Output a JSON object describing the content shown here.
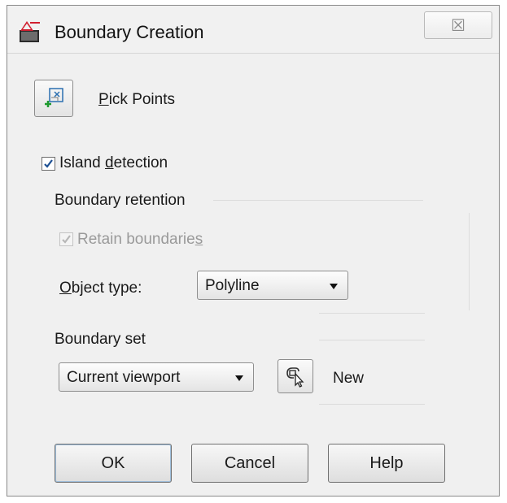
{
  "window": {
    "title": "Boundary Creation",
    "close_glyph": "☒",
    "icon": "autocad-app-icon"
  },
  "pick_points": {
    "label_underlined": "P",
    "label_rest": "ick Points",
    "icon": "pick-points-icon"
  },
  "island_detection": {
    "checked": true,
    "label_pre": "Island ",
    "label_underlined": "d",
    "label_rest": "etection"
  },
  "boundary_retention": {
    "heading": "Boundary retention",
    "retain": {
      "checked": true,
      "disabled": true,
      "label_pre": "Retain boundarie",
      "label_underlined": "s"
    },
    "object_type": {
      "label_underlined": "O",
      "label_rest": "bject type:",
      "value": "Polyline"
    }
  },
  "boundary_set": {
    "heading": "Boundary set",
    "value": "Current viewport",
    "select_icon": "select-objects-icon",
    "new_label": "New"
  },
  "buttons": {
    "ok": "OK",
    "cancel": "Cancel",
    "help": "Help"
  },
  "colors": {
    "accent": "#c8102e",
    "check": "#1c4f93"
  }
}
